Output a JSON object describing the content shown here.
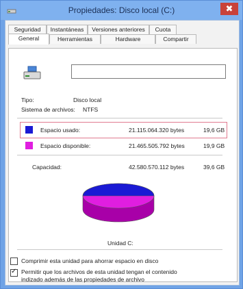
{
  "window": {
    "title": "Propiedades: Disco local (C:)",
    "close_glyph": "✖"
  },
  "tabs_top": [
    "Seguridad",
    "Instantáneas",
    "Versiones anteriores",
    "Cuota"
  ],
  "tabs_bottom": [
    "General",
    "Herramientas",
    "Hardware",
    "Compartir"
  ],
  "active_tab": "General",
  "general": {
    "name_value": "",
    "type_label": "Tipo:",
    "type_value": "Disco local",
    "fs_label": "Sistema de archivos:",
    "fs_value": "NTFS",
    "used_label": "Espacio usado:",
    "used_bytes": "21.115.064.320 bytes",
    "used_gb": "19,6 GB",
    "used_bytes_num": 21115064320,
    "free_label": "Espacio disponible:",
    "free_bytes": "21.465.505.792 bytes",
    "free_gb": "19,9 GB",
    "free_bytes_num": 21465505792,
    "capacity_label": "Capacidad:",
    "capacity_bytes": "42.580.570.112 bytes",
    "capacity_gb": "39,6 GB",
    "drive_label": "Unidad C:",
    "compress_label": "Comprimir esta unidad para ahorrar espacio en disco",
    "compress_checked": false,
    "index_label_1": "Permitir que los archivos de esta unidad tengan el contenido",
    "index_label_2": "indizado además de las propiedades de archivo",
    "index_checked": true
  },
  "colors": {
    "used": "#1a1ad4",
    "free": "#e01ee0",
    "highlight": "#e07a8f",
    "titlebar": "#7fb1ef"
  },
  "icons": {
    "title": "drive-icon",
    "drive": "drive-icon",
    "close": "close-icon"
  }
}
